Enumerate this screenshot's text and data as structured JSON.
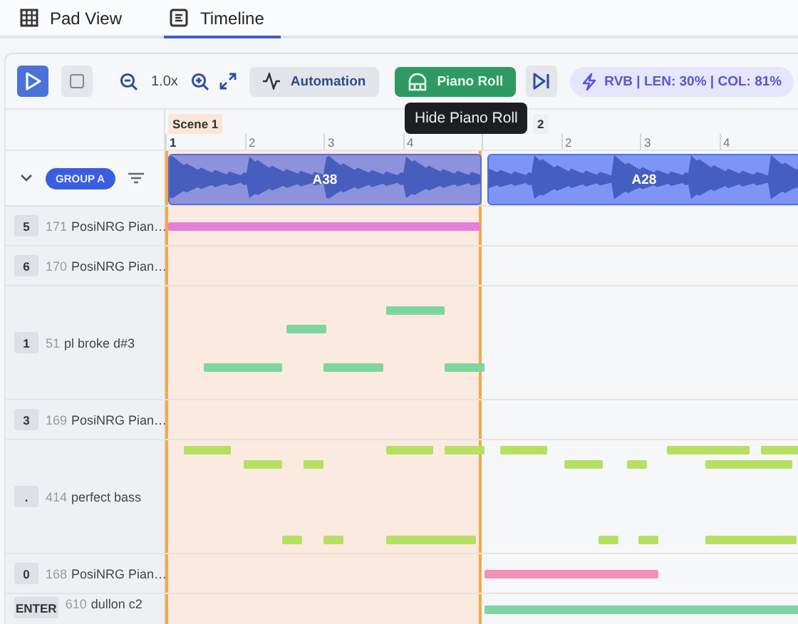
{
  "tabs": [
    {
      "label": "Pad View",
      "selected": false
    },
    {
      "label": "Timeline",
      "selected": true
    }
  ],
  "toolbar": {
    "play_selected": true,
    "zoom": "1.0x",
    "automation": "Automation",
    "piano_roll": {
      "label": "Piano Roll",
      "on": true
    },
    "tooltip": "Hide Piano Roll",
    "status": "RVB | LEN: 30% | COL: 81%"
  },
  "ruler": {
    "scenes": [
      {
        "label": "Scene 1",
        "selected": true,
        "beats": [
          "1",
          "2",
          "3",
          "4"
        ]
      },
      {
        "label": "2",
        "selected": false,
        "beats": [
          "2",
          "3",
          "4"
        ]
      }
    ]
  },
  "group": {
    "label": "GROUP A",
    "expanded": true
  },
  "clips": [
    {
      "label": "A38",
      "selected": false
    },
    {
      "label": "A28",
      "selected": true
    }
  ],
  "tracks": [
    {
      "key": "5",
      "number": "171",
      "name": "PosiNRG Pian…",
      "color": "#e57fd8"
    },
    {
      "key": "6",
      "number": "170",
      "name": "PosiNRG Pian…"
    },
    {
      "key": "1",
      "number": "51",
      "name": "pl broke d#3",
      "color": "#7dd6a0"
    },
    {
      "key": "3",
      "number": "169",
      "name": "PosiNRG Pian…"
    },
    {
      "key": ".",
      "number": "414",
      "name": "perfect bass",
      "color": "#b5e061"
    },
    {
      "key": "0",
      "number": "168",
      "name": "PosiNRG Pian…",
      "color": "#f290b8"
    },
    {
      "key": "ENTER",
      "number": "610",
      "name": "dullon c2",
      "color": "#7dd6a0"
    }
  ]
}
